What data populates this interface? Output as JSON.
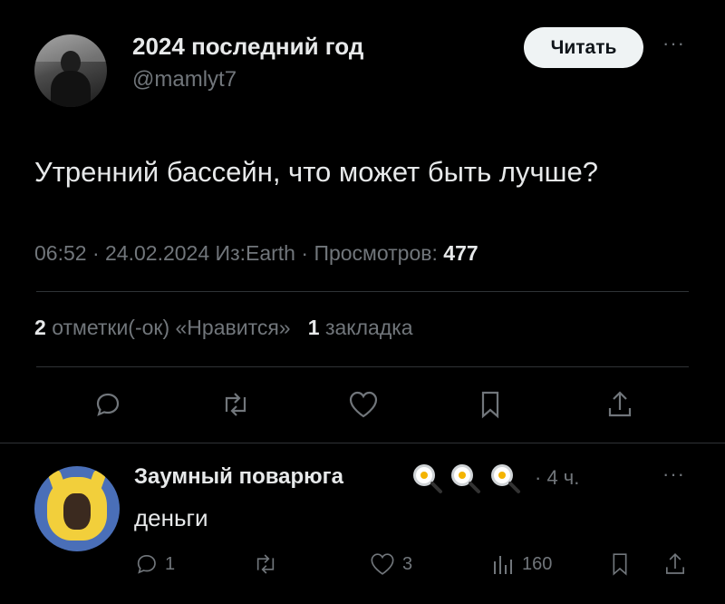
{
  "tweet": {
    "author_name": "2024 последний год",
    "author_handle": "@mamlyt7",
    "follow_label": "Читать",
    "text": "Утренний бассейн, что может быть лучше?",
    "meta": {
      "time": "06:52",
      "date": "24.02.2024",
      "source": "Из:Earth",
      "views_label": "Просмотров:",
      "views": "477"
    },
    "stats": {
      "likes_count": "2",
      "likes_label": "отметки(-ок) «Нравится»",
      "bookmarks_count": "1",
      "bookmarks_label": "закладка"
    },
    "actions": [
      "reply-icon",
      "retweet-icon",
      "heart-icon",
      "bookmark-icon",
      "share-icon"
    ]
  },
  "reply": {
    "author_name": "Заумный поварюга",
    "badges": [
      "fried-egg-pan-icon",
      "fried-egg-pan-icon",
      "fried-egg-pan-icon"
    ],
    "time": "· 4 ч.",
    "text": "деньги",
    "actions": {
      "replies": "1",
      "likes": "3",
      "views": "160"
    }
  },
  "colors": {
    "background": "#000000",
    "text": "#e7e9ea",
    "muted": "#71767b",
    "divider": "#2f3336",
    "button_bg": "#eff3f4"
  }
}
